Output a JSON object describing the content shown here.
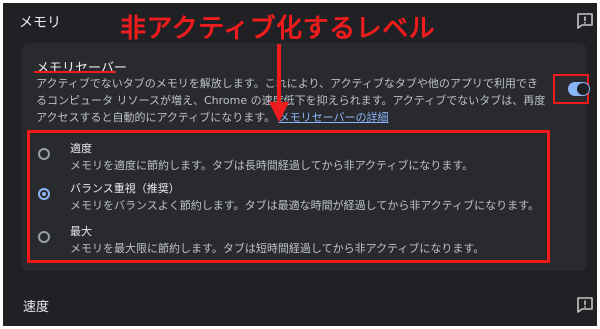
{
  "page": {
    "section_title": "メモリ",
    "next_section_title": "速度"
  },
  "annotation": {
    "title": "非アクティブ化するレベル"
  },
  "memory_saver": {
    "heading": "メモリセーバー",
    "description": "アクティブでないタブのメモリを解放します。これにより、アクティブなタブや他のアプリで利用できるコンピュータ リソースが増え、Chrome の速度低下を抑えられます。アクティブでないタブは、再度アクセスすると自動的にアクティブになります。",
    "link_text": "メモリセーバーの詳細",
    "enabled": true
  },
  "options": [
    {
      "title": "適度",
      "description": "メモリを適度に節約します。タブは長時間経過してから非アクティブになります。",
      "selected": false
    },
    {
      "title": "バランス重視（推奨）",
      "description": "メモリをバランスよく節約します。タブは最適な時間が経過してから非アクティブになります。",
      "selected": true
    },
    {
      "title": "最大",
      "description": "メモリを最大限に節約します。タブは短時間経過してから非アクティブになります。",
      "selected": false
    }
  ],
  "colors": {
    "background": "#202124",
    "card": "#292a2d",
    "accent": "#8ab4f8",
    "annotation_red": "#ee1c1c"
  },
  "icons": {
    "feedback": "feedback-icon",
    "arrow": "arrow-down-annotation"
  }
}
